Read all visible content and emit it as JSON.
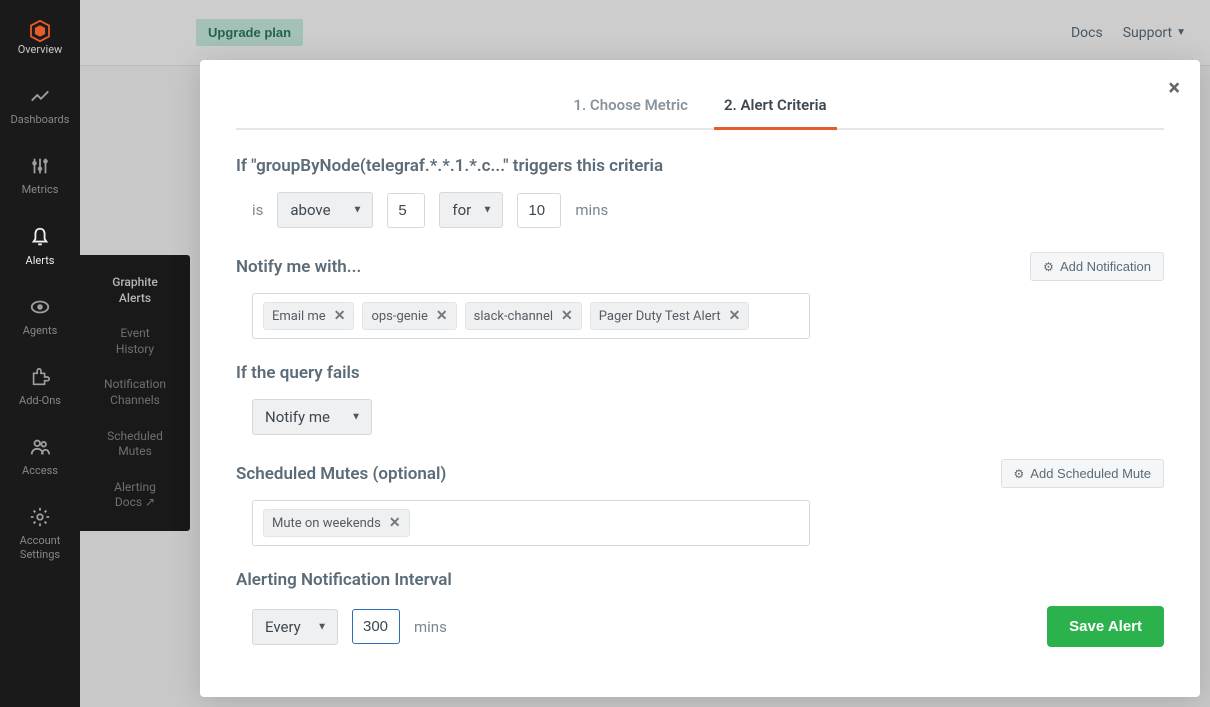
{
  "sidebar": {
    "items": [
      {
        "label": "Overview"
      },
      {
        "label": "Dashboards"
      },
      {
        "label": "Metrics"
      },
      {
        "label": "Alerts"
      },
      {
        "label": "Agents"
      },
      {
        "label": "Add-Ons"
      },
      {
        "label": "Access"
      },
      {
        "label": "Account\nSettings"
      }
    ],
    "submenu": [
      {
        "label": "Graphite\nAlerts",
        "active": true
      },
      {
        "label": "Event\nHistory"
      },
      {
        "label": "Notification\nChannels"
      },
      {
        "label": "Scheduled\nMutes"
      },
      {
        "label": "Alerting\nDocs ↗"
      }
    ]
  },
  "topbar": {
    "upgrade": "Upgrade plan",
    "docs": "Docs",
    "support": "Support"
  },
  "modal": {
    "tabs": [
      {
        "label": "1. Choose Metric",
        "active": false
      },
      {
        "label": "2. Alert Criteria",
        "active": true
      }
    ],
    "criteria": {
      "title": "If \"groupByNode(telegraf.*.*.1.*.c...\" triggers this criteria",
      "is_label": "is",
      "comparator": "above",
      "threshold": "5",
      "for_label": "for",
      "duration": "10",
      "duration_unit": "mins"
    },
    "notify": {
      "title": "Notify me with...",
      "add_button": "Add Notification",
      "tags": [
        "Email me",
        "ops-genie",
        "slack-channel",
        "Pager Duty Test Alert"
      ]
    },
    "query_fail": {
      "title": "If the query fails",
      "action": "Notify me"
    },
    "mutes": {
      "title": "Scheduled Mutes (optional)",
      "add_button": "Add Scheduled Mute",
      "tags": [
        "Mute on weekends"
      ]
    },
    "interval": {
      "title": "Alerting Notification Interval",
      "mode": "Every",
      "value": "300",
      "unit": "mins"
    },
    "save": "Save Alert"
  }
}
